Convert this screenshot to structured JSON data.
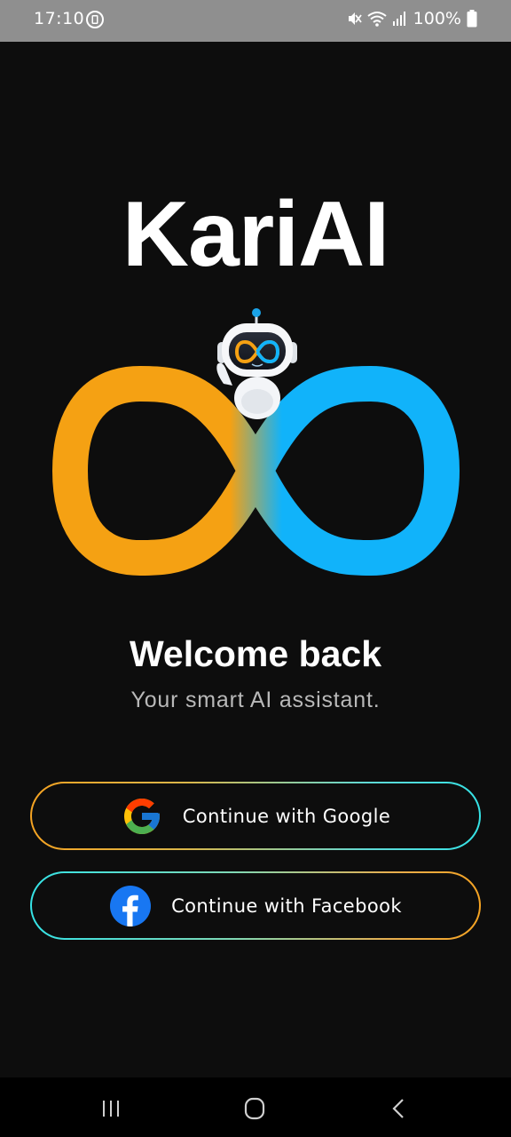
{
  "status_bar": {
    "time": "17:10",
    "battery_text": "100%",
    "icons": [
      "screen-record-icon",
      "mute-icon",
      "wifi-icon",
      "signal-icon",
      "battery-icon"
    ]
  },
  "app": {
    "title": "KariAI",
    "logo_icon": "infinity-robot-logo",
    "colors": {
      "orange": "#F5A113",
      "blue": "#11B3FA",
      "background": "#0D0D0D"
    }
  },
  "welcome": {
    "title": "Welcome back",
    "subtitle": "Your smart AI assistant."
  },
  "buttons": {
    "google": {
      "label": "Continue with Google",
      "icon": "google-icon"
    },
    "facebook": {
      "label": "Continue with Facebook",
      "icon": "facebook-icon"
    }
  },
  "nav_bar": {
    "items": [
      "recents-icon",
      "home-icon",
      "back-icon"
    ]
  }
}
